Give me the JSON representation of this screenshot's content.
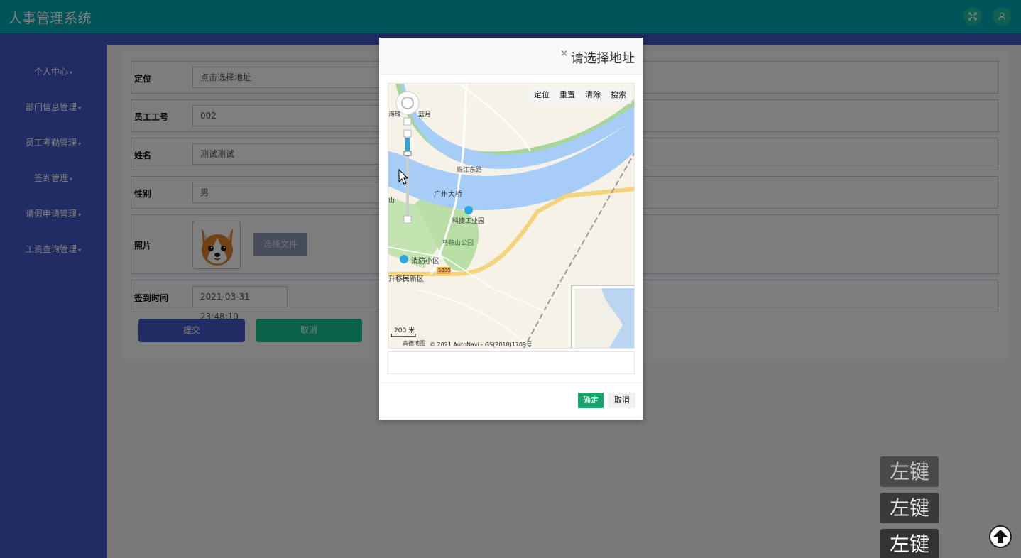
{
  "app": {
    "title": "人事管理系统"
  },
  "sidebar": {
    "items": [
      {
        "label": "个人中心"
      },
      {
        "label": "部门信息管理"
      },
      {
        "label": "员工考勤管理"
      },
      {
        "label": "签到管理"
      },
      {
        "label": "请假申请管理"
      },
      {
        "label": "工资查询管理"
      }
    ]
  },
  "form": {
    "location_label": "定位",
    "location_placeholder": "点击选择地址",
    "empno_label": "员工工号",
    "empno_value": "002",
    "name_label": "姓名",
    "name_value": "测试测试",
    "gender_label": "性别",
    "gender_value": "男",
    "photo_label": "照片",
    "choose_file_label": "选择文件",
    "signtime_label": "签到时间",
    "signtime_value": "2021-03-31 23:48:10",
    "submit_label": "提交",
    "cancel_label": "取消"
  },
  "dialog": {
    "title": "请选择地址",
    "close": "×",
    "toolbar": [
      "定位",
      "重置",
      "清除",
      "搜索"
    ],
    "map_labels": {
      "bridge": "广州大桥",
      "park1": "科捷工业园",
      "park2": "马鞍山公园",
      "district": "消防小区",
      "road": "珠江东路",
      "road_code": "S335",
      "area1": "海珠",
      "area2": "蓝月",
      "area3": "升移民新区",
      "area4": "山",
      "scale": "200 米",
      "attribution": "© 2021 AutoNavi - GS(2018)1709号",
      "brand": "高德地图"
    },
    "ok_label": "确定",
    "cancel_label": "取消"
  },
  "key_badges": [
    "左键",
    "左键",
    "左键"
  ],
  "colors": {
    "topbar": "#00a8b4",
    "sidebar": "#4458c8",
    "accent_green": "#12a56a"
  }
}
